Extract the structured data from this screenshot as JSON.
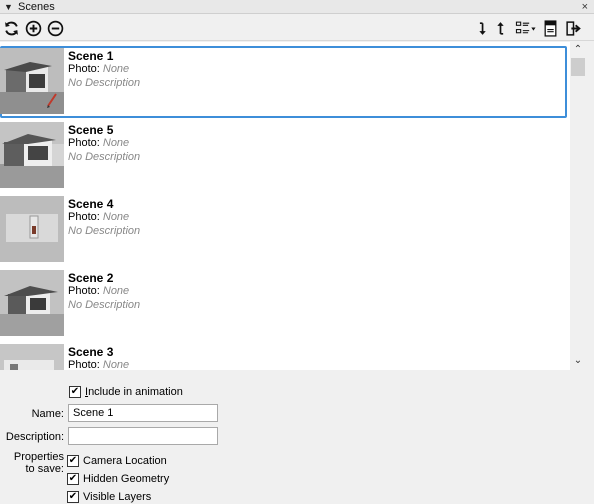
{
  "panel": {
    "title": "Scenes",
    "collapse_glyph": "▼",
    "close_glyph": "×"
  },
  "toolbar": {
    "left_icons": [
      "refresh-icon",
      "add-scene-icon",
      "remove-scene-icon"
    ],
    "right_icons": [
      "move-scene-down-icon",
      "move-scene-up-icon",
      "view-options-icon",
      "show-details-icon",
      "export-icon"
    ]
  },
  "scenes": [
    {
      "name": "Scene 1",
      "photo_label": "Photo:",
      "photo_value": "None",
      "description": "No Description",
      "selected": true
    },
    {
      "name": "Scene 5",
      "photo_label": "Photo:",
      "photo_value": "None",
      "description": "No Description",
      "selected": false
    },
    {
      "name": "Scene 4",
      "photo_label": "Photo:",
      "photo_value": "None",
      "description": "No Description",
      "selected": false
    },
    {
      "name": "Scene 2",
      "photo_label": "Photo:",
      "photo_value": "None",
      "description": "No Description",
      "selected": false
    },
    {
      "name": "Scene 3",
      "photo_label": "Photo:",
      "photo_value": "None",
      "description": "",
      "selected": false
    }
  ],
  "properties": {
    "include_in_animation": {
      "label_pre": "",
      "label_underline": "I",
      "label_post": "nclude in animation",
      "checked": true
    },
    "name_label": "Name:",
    "name_value": "Scene 1",
    "description_label": "Description:",
    "description_value": "",
    "properties_to_save_label_1": "Properties",
    "properties_to_save_label_2": "to save:",
    "save_options": [
      {
        "label": "Camera Location",
        "checked": true
      },
      {
        "label": "Hidden Geometry",
        "checked": true
      },
      {
        "label": "Visible Layers",
        "checked": true
      }
    ]
  },
  "colors": {
    "selection": "#3d8ed9",
    "muted_text": "#888888"
  }
}
